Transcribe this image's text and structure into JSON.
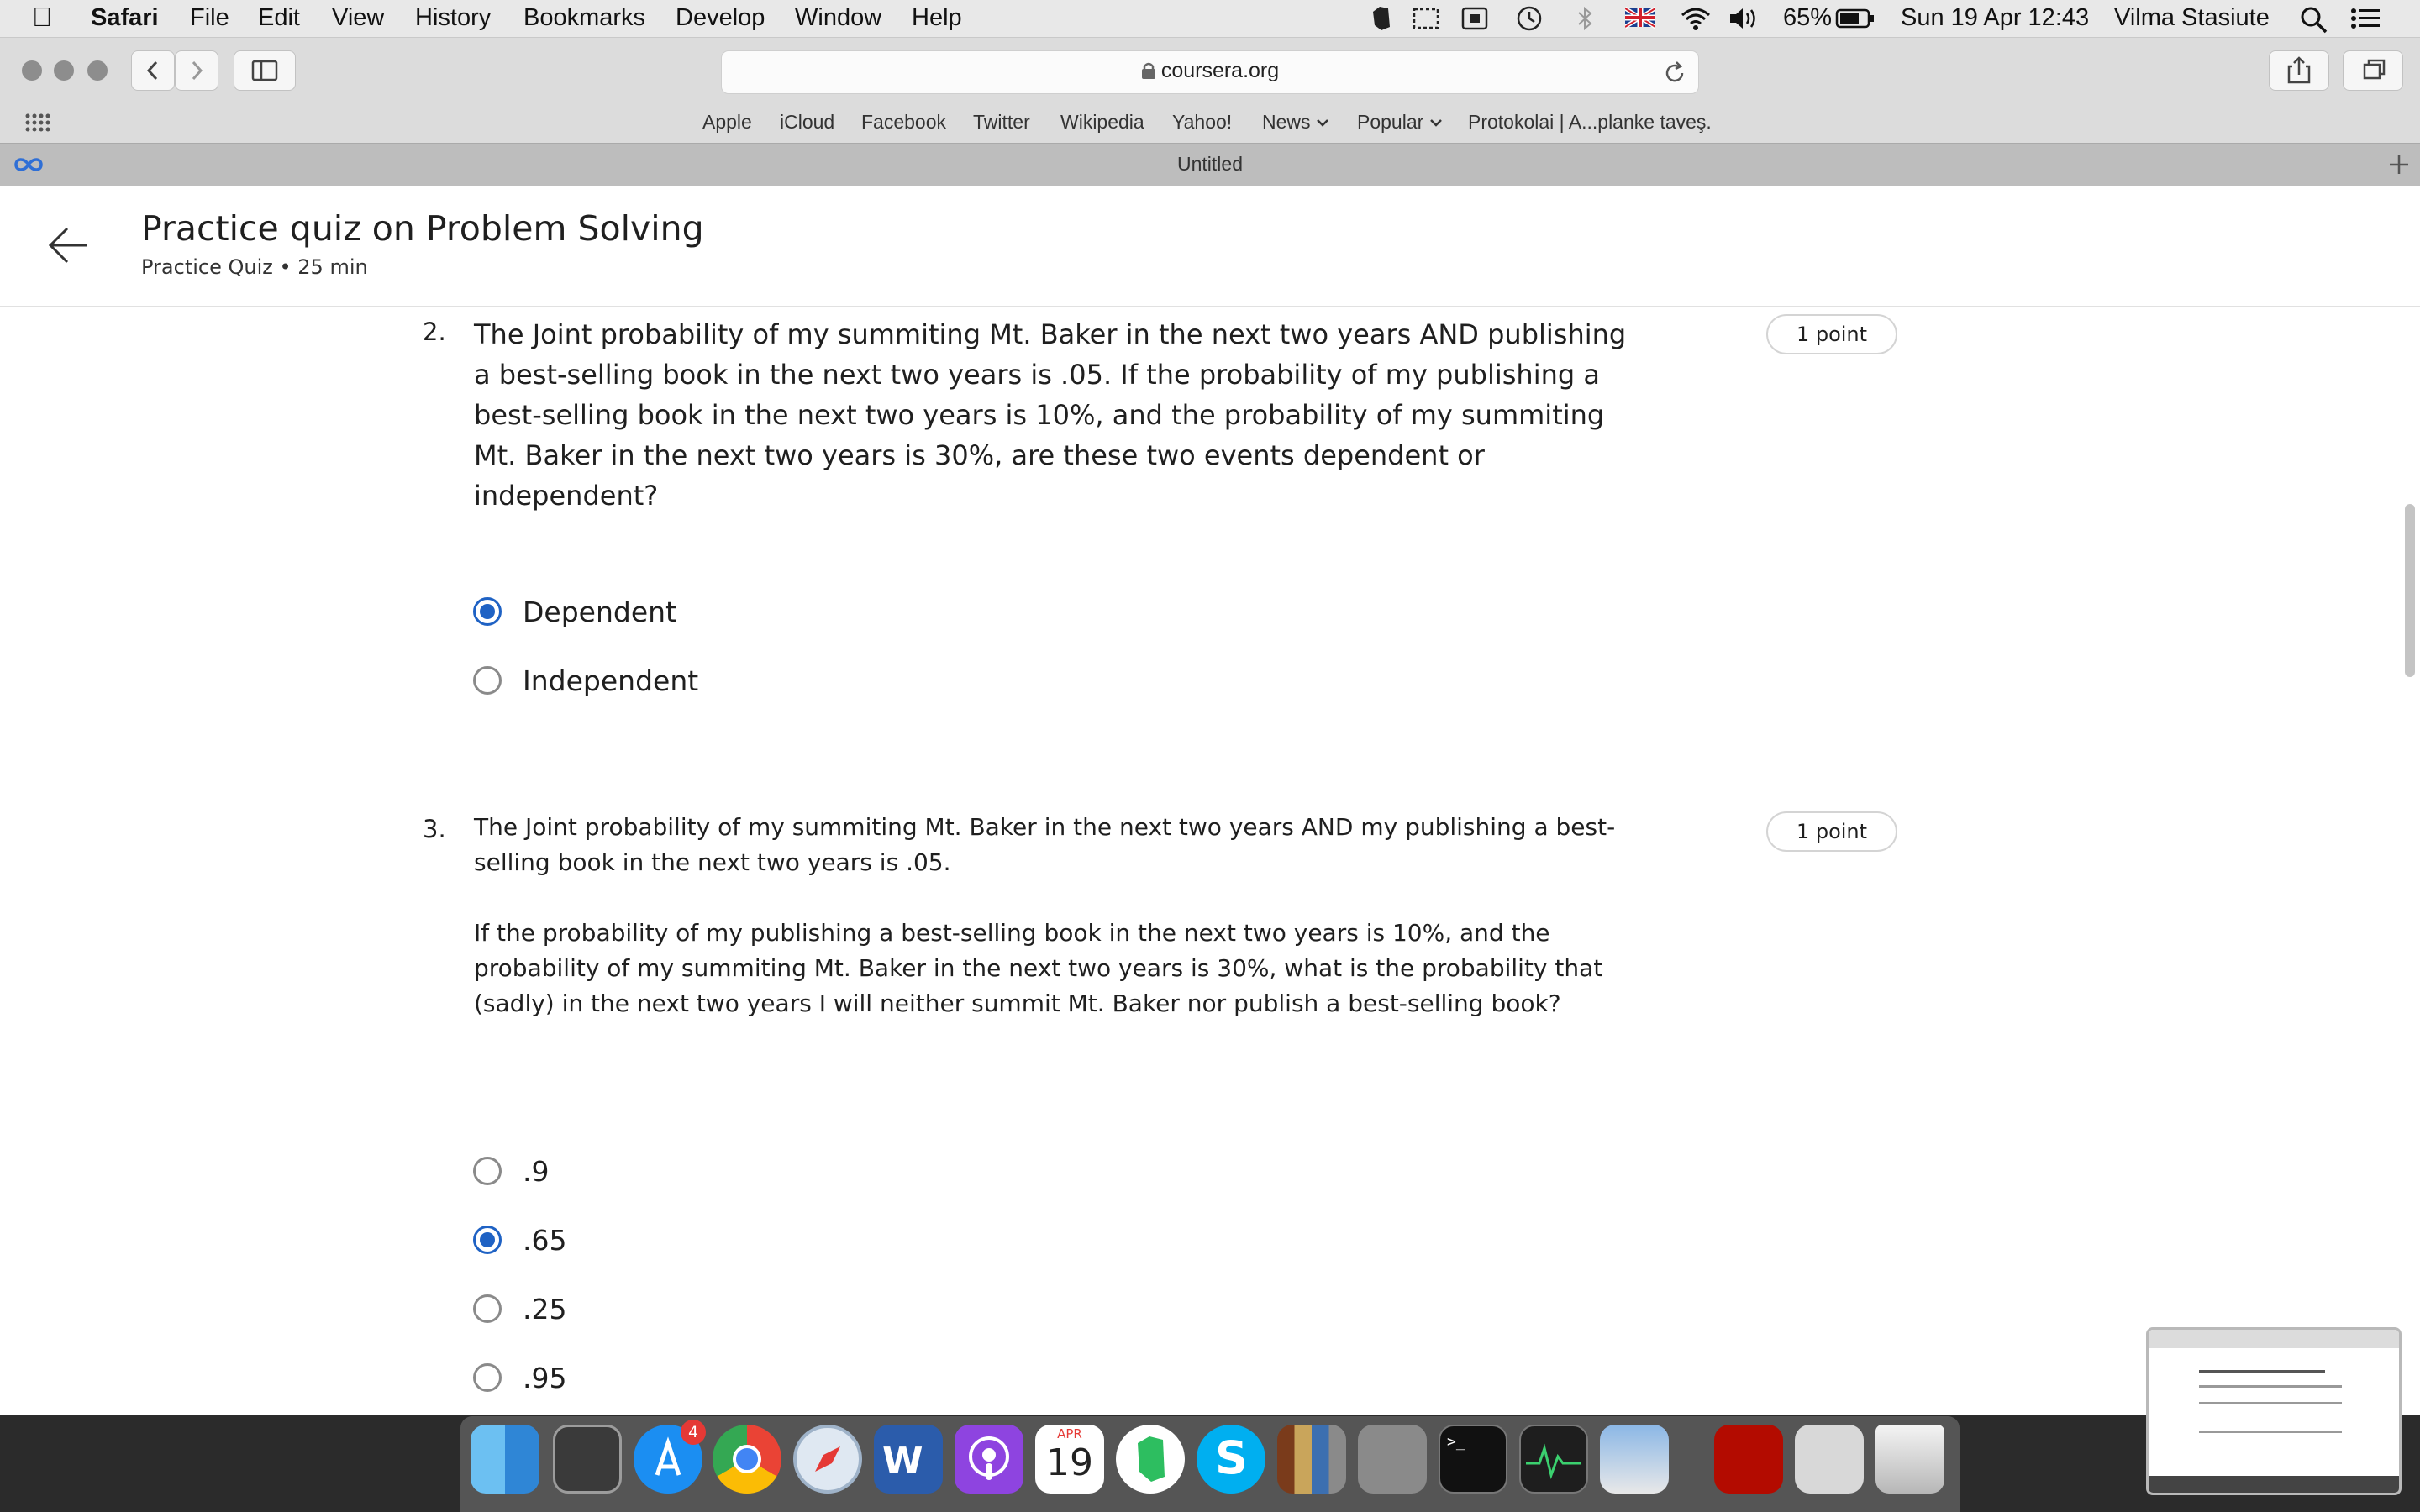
{
  "menubar": {
    "app_name": "Safari",
    "items": [
      "File",
      "Edit",
      "View",
      "History",
      "Bookmarks",
      "Develop",
      "Window",
      "Help"
    ],
    "battery": "65%",
    "datetime": "Sun 19 Apr  12:43",
    "user": "Vilma Stasiute"
  },
  "browser": {
    "url": "coursera.org",
    "favorites": [
      "Apple",
      "iCloud",
      "Facebook",
      "Twitter",
      "Wikipedia",
      "Yahoo!",
      "News",
      "Popular",
      "Protokolai | A...planke taveş."
    ],
    "tab_title": "Untitled"
  },
  "header": {
    "title": "Practice quiz on Problem Solving",
    "subtitle": "Practice Quiz • 25 min"
  },
  "questions": [
    {
      "number": "2.",
      "points": "1 point",
      "text": "The Joint probability of my summiting Mt. Baker in the next two years AND publishing a best-selling book in the next two years is .05. If the probability of my publishing a best-selling book in the next two years is 10%, and the probability of my summiting Mt. Baker in the next two years is 30%, are these two events dependent or independent?",
      "options": [
        {
          "label": "Dependent",
          "selected": true
        },
        {
          "label": "Independent",
          "selected": false
        }
      ]
    },
    {
      "number": "3.",
      "points": "1 point",
      "text_p1": "The Joint probability of my summiting Mt. Baker in the next two years AND my publishing a best-selling book in the next two years is .05.",
      "text_p2": "If the probability of my publishing a best-selling book in the next two years is 10%, and the probability of my summiting Mt. Baker in the next two years is 30%, what is the probability that (sadly) in the next two years I will neither summit Mt. Baker nor publish a best-selling book?",
      "options": [
        {
          "label": ".9",
          "selected": false
        },
        {
          "label": ".65",
          "selected": true
        },
        {
          "label": ".25",
          "selected": false
        },
        {
          "label": ".95",
          "selected": false
        }
      ]
    }
  ],
  "dock": {
    "calendar_month": "APR",
    "calendar_day": "19",
    "appstore_badge": "4"
  },
  "colors": {
    "accent": "#1f62c4",
    "menubar": "#e8e8e8",
    "tabbar": "#bdbdbd"
  }
}
